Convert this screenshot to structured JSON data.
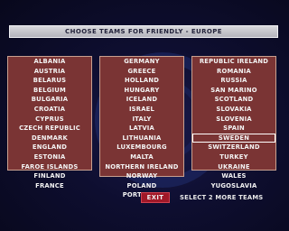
{
  "header": {
    "title": "CHOOSE TEAMS FOR FRIENDLY - EUROPE"
  },
  "teams": {
    "column1": [
      "ALBANIA",
      "AUSTRIA",
      "BELARUS",
      "BELGIUM",
      "BULGARIA",
      "CROATIA",
      "CYPRUS",
      "CZECH REPUBLIC",
      "DENMARK",
      "ENGLAND",
      "ESTONIA",
      "FAROE ISLANDS",
      "FINLAND",
      "FRANCE"
    ],
    "column2": [
      "GERMANY",
      "GREECE",
      "HOLLAND",
      "HUNGARY",
      "ICELAND",
      "ISRAEL",
      "ITALY",
      "LATVIA",
      "LITHUANIA",
      "LUXEMBOURG",
      "MALTA",
      "NORTHERN IRELAND",
      "NORWAY",
      "POLAND",
      "PORTUGAL"
    ],
    "column3": [
      "REPUBLIC IRELAND",
      "ROMANIA",
      "RUSSIA",
      "SAN MARINO",
      "SCOTLAND",
      "SLOVAKIA",
      "SLOVENIA",
      "SPAIN",
      "SWEDEN",
      "SWITZERLAND",
      "TURKEY",
      "UKRAINE",
      "WALES",
      "YUGOSLAVIA"
    ],
    "selected": "SWEDEN"
  },
  "footer": {
    "exit_label": "EXIT",
    "status": "SELECT 2 MORE TEAMS"
  },
  "colors": {
    "team_cell": "#7a3434",
    "exit_button": "#a01828",
    "background": "#0a0a22"
  }
}
